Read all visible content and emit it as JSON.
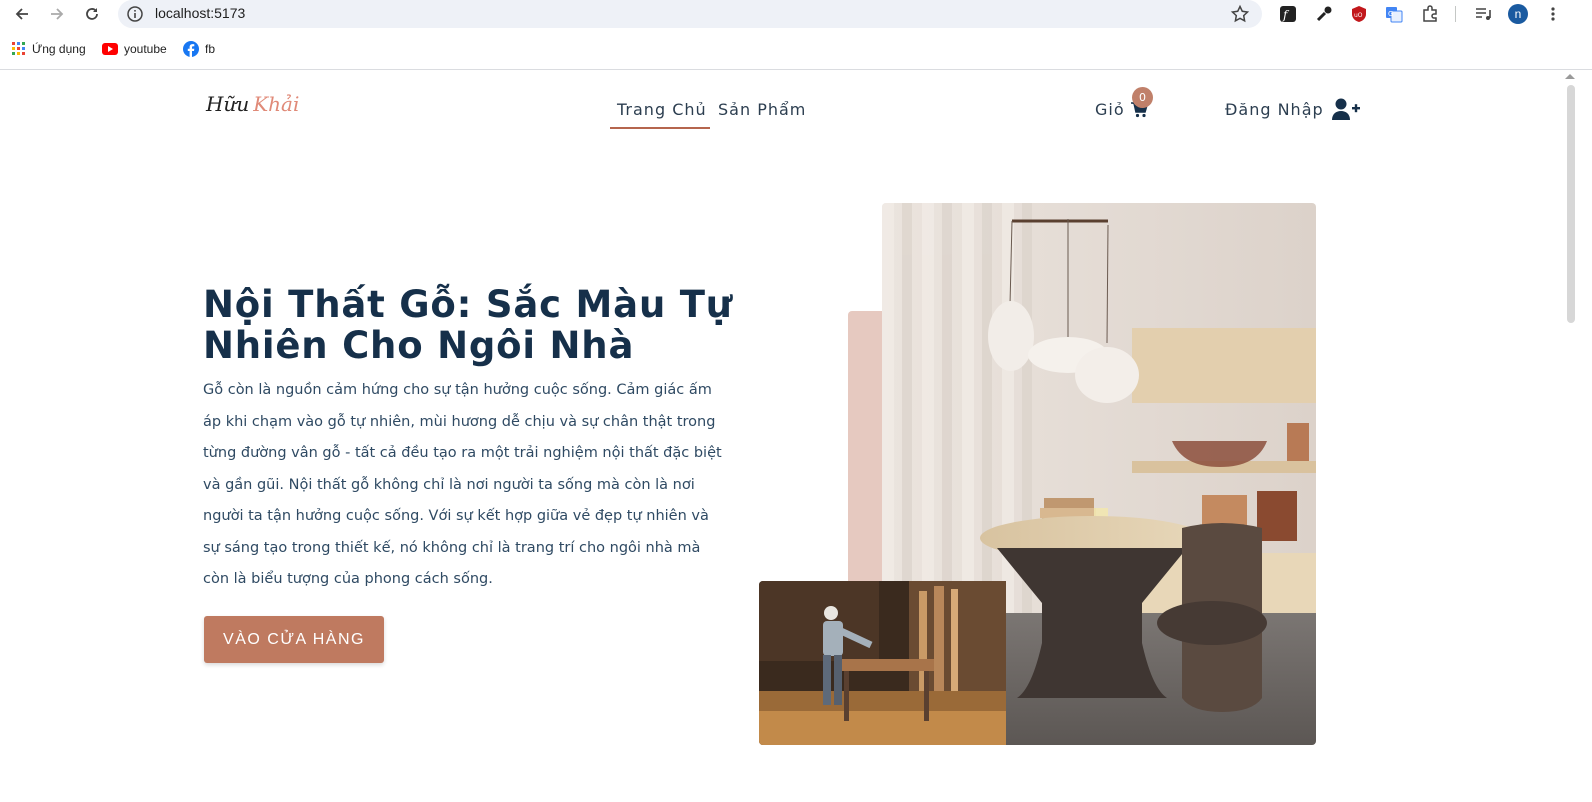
{
  "browser": {
    "url": "localhost:5173",
    "profile_initial": "n",
    "bookmarks": [
      {
        "label": "Ứng dụng",
        "icon": "apps-grid-icon"
      },
      {
        "label": "youtube",
        "icon": "youtube-icon"
      },
      {
        "label": "fb",
        "icon": "facebook-icon"
      }
    ]
  },
  "header": {
    "logo_part1": "Hữu",
    "logo_part2": "Khải",
    "menu": [
      {
        "label": "Trang Chủ",
        "active": true
      },
      {
        "label": "Sản Phẩm",
        "active": false
      }
    ],
    "cart_label": "Giỏ",
    "cart_count": "0",
    "login_label": "Đăng Nhập"
  },
  "hero": {
    "title": "Nội Thất Gỗ: Sắc Màu Tự Nhiên Cho Ngôi Nhà",
    "text": "Gỗ còn là nguồn cảm hứng cho sự tận hưởng cuộc sống. Cảm giác ấm áp khi chạm vào gỗ tự nhiên, mùi hương dễ chịu và sự chân thật trong từng đường vân gỗ - tất cả đều tạo ra một trải nghiệm nội thất đặc biệt và gần gũi. Nội thất gỗ không chỉ là nơi người ta sống mà còn là nơi người ta tận hưởng cuộc sống. Với sự kết hợp giữa vẻ đẹp tự nhiên và sự sáng tạo trong thiết kế, nó không chỉ là trang trí cho ngôi nhà mà còn là biểu tượng của phong cách sống.",
    "cta_label": "VÀO CỬA HÀNG"
  },
  "colors": {
    "accent": "#bf7a60",
    "title": "#16304a",
    "text": "#2f4a63",
    "pink_block": "#e6c9c0"
  }
}
